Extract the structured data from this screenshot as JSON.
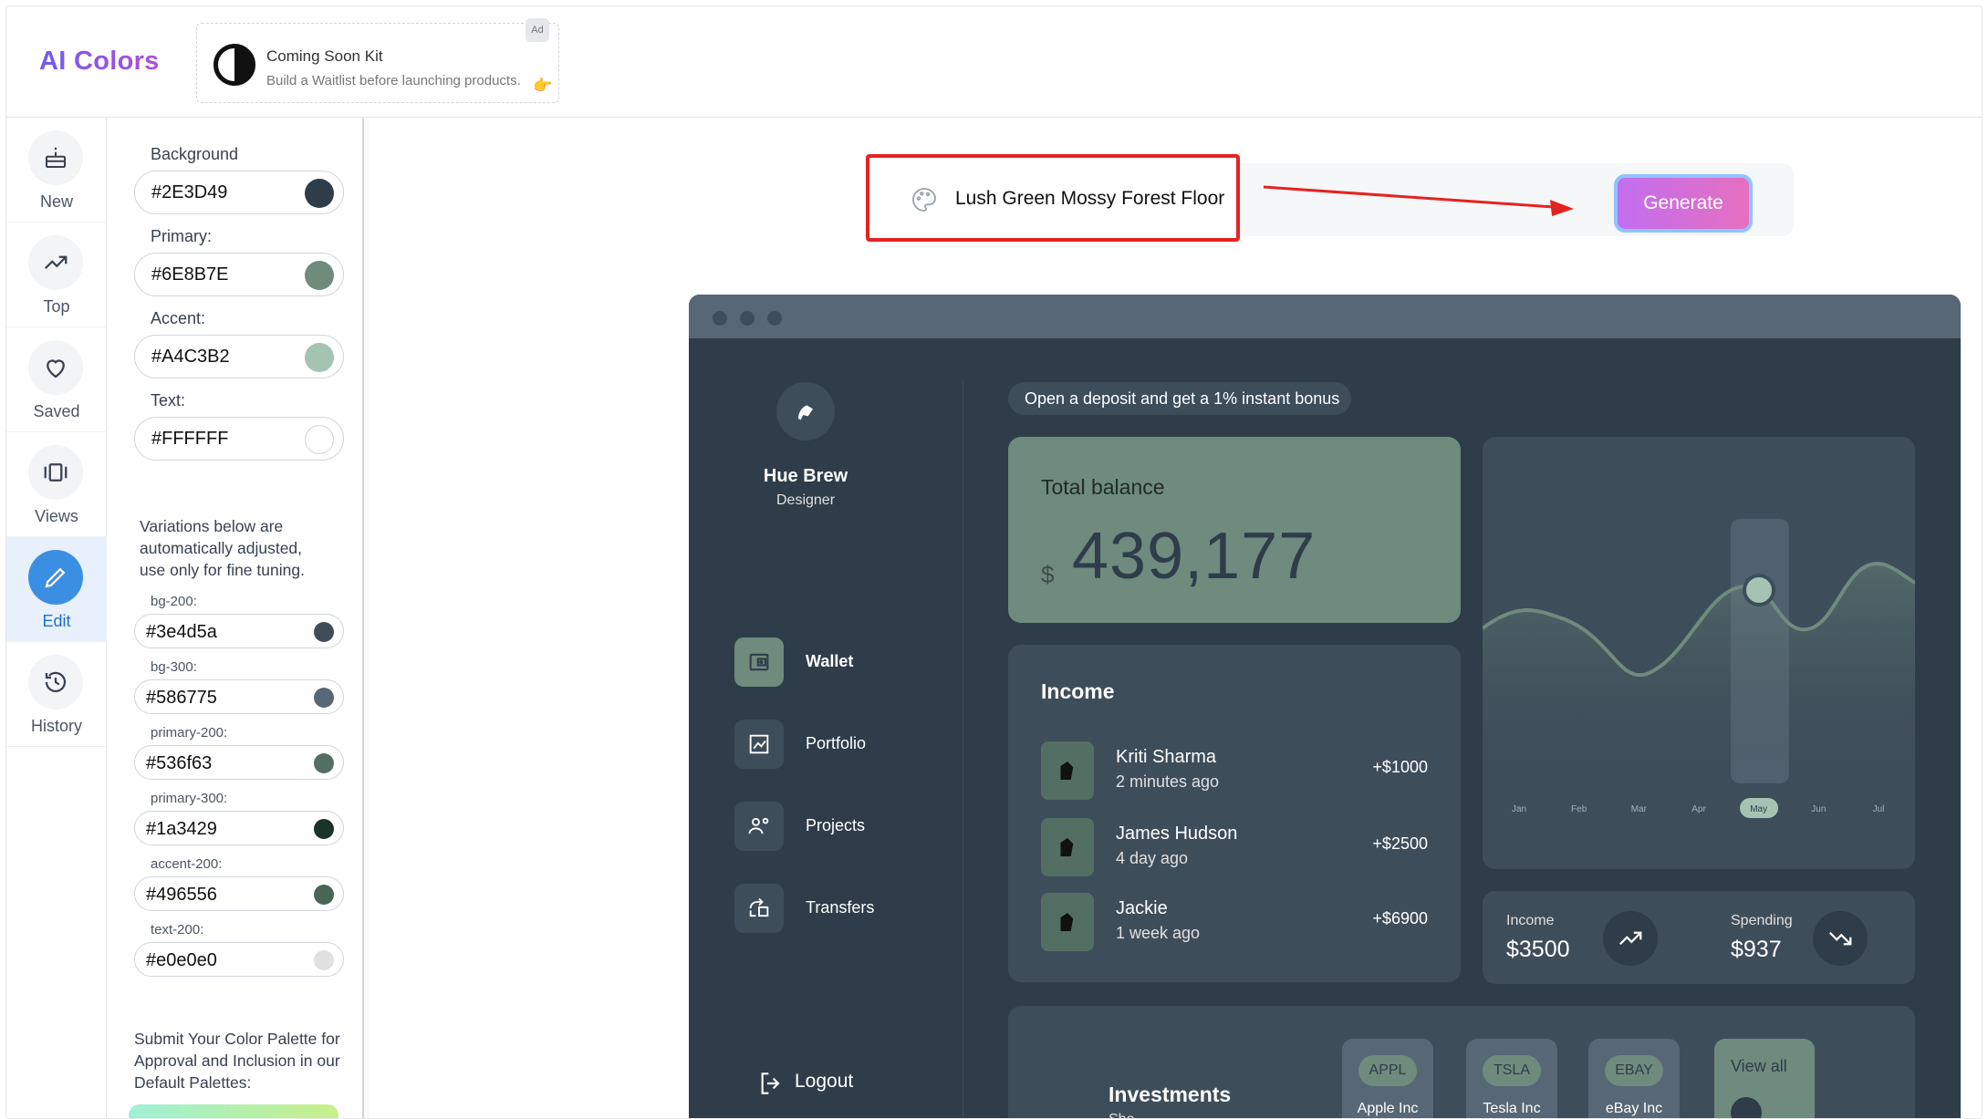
{
  "app": {
    "title": "AI Colors"
  },
  "ad": {
    "title": "Coming Soon Kit",
    "subtitle": "Build a Waitlist before launching products.",
    "badge": "Ad"
  },
  "nav": [
    {
      "label": "New",
      "icon": "cake-icon"
    },
    {
      "label": "Top",
      "icon": "trending-up-icon"
    },
    {
      "label": "Saved",
      "icon": "heart-icon"
    },
    {
      "label": "Views",
      "icon": "views-icon"
    },
    {
      "label": "Edit",
      "icon": "pencil-icon",
      "active": true
    },
    {
      "label": "History",
      "icon": "history-icon"
    }
  ],
  "colors": {
    "background": {
      "label": "Background",
      "value": "#2E3D49"
    },
    "primary": {
      "label": "Primary:",
      "value": "#6E8B7E"
    },
    "accent": {
      "label": "Accent:",
      "value": "#A4C3B2"
    },
    "text": {
      "label": "Text:",
      "value": "#FFFFFF"
    }
  },
  "variations_note": "Variations below are automatically adjusted, use only for fine tuning.",
  "variations": [
    {
      "label": "bg-200:",
      "value": "#3e4d5a"
    },
    {
      "label": "bg-300:",
      "value": "#586775"
    },
    {
      "label": "primary-200:",
      "value": "#536f63"
    },
    {
      "label": "primary-300:",
      "value": "#1a3429"
    },
    {
      "label": "accent-200:",
      "value": "#496556"
    },
    {
      "label": "text-200:",
      "value": "#e0e0e0"
    }
  ],
  "submit_note": "Submit Your Color Palette for Approval and Inclusion in our Default Palettes:",
  "prompt": {
    "text": "Lush Green Mossy Forest Floor",
    "icon": "palette-icon"
  },
  "generate_label": "Generate",
  "preview": {
    "user": {
      "name": "Hue Brew",
      "role": "Designer"
    },
    "menu": [
      {
        "label": "Wallet",
        "icon": "wallet-icon",
        "active": true
      },
      {
        "label": "Portfolio",
        "icon": "portfolio-icon"
      },
      {
        "label": "Projects",
        "icon": "projects-icon"
      },
      {
        "label": "Transfers",
        "icon": "transfers-icon"
      }
    ],
    "logout": "Logout",
    "promo": "Open a deposit and get a 1% instant bonus",
    "balance": {
      "title": "Total balance",
      "currency": "$",
      "value": "439,177"
    },
    "income": {
      "title": "Income",
      "rows": [
        {
          "name": "Kriti Sharma",
          "time": "2 minutes ago",
          "amount": "+$1000"
        },
        {
          "name": "James Hudson",
          "time": "4 day ago",
          "amount": "+$2500"
        },
        {
          "name": "Jackie",
          "time": "1 week ago",
          "amount": "+$6900"
        }
      ]
    },
    "stats": {
      "income_label": "Income",
      "income_value": "$3500",
      "spending_label": "Spending",
      "spending_value": "$937"
    },
    "investments": {
      "title": "Investments",
      "subtitle": "Sho...",
      "cards": [
        {
          "ticker": "APPL",
          "name": "Apple Inc"
        },
        {
          "ticker": "TSLA",
          "name": "Tesla Inc"
        },
        {
          "ticker": "EBAY",
          "name": "eBay Inc"
        }
      ],
      "view_all": "View all"
    }
  },
  "chart_data": {
    "type": "line",
    "categories": [
      "Jan",
      "Feb",
      "Mar",
      "Apr",
      "May",
      "Jun",
      "Jul"
    ],
    "selected": "May",
    "xlabel": "",
    "ylabel": ""
  }
}
